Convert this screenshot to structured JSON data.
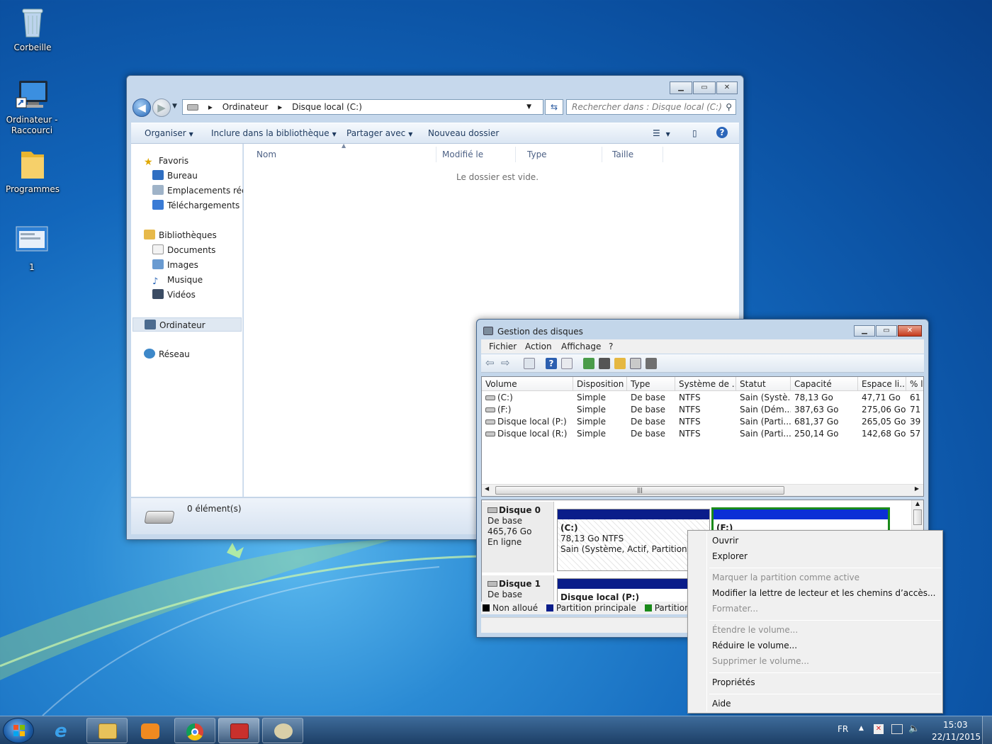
{
  "desktop": {
    "icons": [
      {
        "label": "Corbeille",
        "icon": "recycle-bin-icon"
      },
      {
        "label": "Ordinateur - Raccourci",
        "icon": "computer-shortcut-icon"
      },
      {
        "label": "Programmes",
        "icon": "folder-icon"
      },
      {
        "label": "1",
        "icon": "window-thumbnail-icon"
      }
    ]
  },
  "explorer": {
    "address": [
      "Ordinateur",
      "Disque local (C:)"
    ],
    "search_placeholder": "Rechercher dans : Disque local (C:)",
    "toolbar": {
      "organize": "Organiser",
      "include": "Inclure dans la bibliothèque",
      "share": "Partager avec",
      "new_folder": "Nouveau dossier"
    },
    "nav": {
      "favorites": "Favoris",
      "desktop": "Bureau",
      "recent": "Emplacements récents",
      "downloads": "Téléchargements",
      "libraries": "Bibliothèques",
      "documents": "Documents",
      "images": "Images",
      "music": "Musique",
      "videos": "Vidéos",
      "computer": "Ordinateur",
      "network": "Réseau"
    },
    "columns": [
      "Nom",
      "Modifié le",
      "Type",
      "Taille"
    ],
    "empty_message": "Le dossier est vide.",
    "status": "0 élément(s)"
  },
  "diskmgmt": {
    "title": "Gestion des disques",
    "menu": [
      "Fichier",
      "Action",
      "Affichage",
      "?"
    ],
    "columns": [
      "Volume",
      "Disposition",
      "Type",
      "Système de ...",
      "Statut",
      "Capacité",
      "Espace li...",
      "% l"
    ],
    "rows": [
      [
        "(C:)",
        "Simple",
        "De base",
        "NTFS",
        "Sain (Systè...",
        "78,13 Go",
        "47,71 Go",
        "61"
      ],
      [
        "(F:)",
        "Simple",
        "De base",
        "NTFS",
        "Sain (Dém...",
        "387,63 Go",
        "275,06 Go",
        "71"
      ],
      [
        "Disque local (P:)",
        "Simple",
        "De base",
        "NTFS",
        "Sain (Parti...",
        "681,37 Go",
        "265,05 Go",
        "39"
      ],
      [
        "Disque local (R:)",
        "Simple",
        "De base",
        "NTFS",
        "Sain (Parti...",
        "250,14 Go",
        "142,68 Go",
        "57"
      ]
    ],
    "disk0": {
      "name": "Disque 0",
      "kind": "De base",
      "size": "465,76 Go",
      "state": "En ligne",
      "partC": {
        "label": "(C:)",
        "size": "78,13 Go NTFS",
        "status": "Sain (Système, Actif, Partition principale)"
      },
      "partF": {
        "label": "(F:)"
      }
    },
    "disk1": {
      "name": "Disque 1",
      "kind": "De base",
      "partP": {
        "label": "Disque local  (P:)"
      }
    },
    "legend": [
      "Non alloué",
      "Partition principale",
      "Partition étendue"
    ],
    "legend_colors": [
      "#000000",
      "#0a1d8a",
      "#1a8a1a"
    ]
  },
  "context_menu": [
    {
      "label": "Ouvrir",
      "enabled": true
    },
    {
      "label": "Explorer",
      "enabled": true
    },
    {
      "label": "Marquer la partition comme active",
      "enabled": false
    },
    {
      "label": "Modifier la lettre de lecteur et les chemins d’accès...",
      "enabled": true
    },
    {
      "label": "Formater...",
      "enabled": false
    },
    {
      "label": "Étendre le volume...",
      "enabled": false
    },
    {
      "label": "Réduire le volume...",
      "enabled": true
    },
    {
      "label": "Supprimer le volume...",
      "enabled": false
    },
    {
      "label": "Propriétés",
      "enabled": true
    },
    {
      "label": "Aide",
      "enabled": true
    }
  ],
  "taskbar": {
    "apps": [
      "internet-explorer-icon",
      "explorer-icon",
      "media-player-icon",
      "chrome-icon",
      "toolbox-icon",
      "paint-icon"
    ],
    "lang": "FR",
    "time": "15:03",
    "date": "22/11/2015"
  }
}
